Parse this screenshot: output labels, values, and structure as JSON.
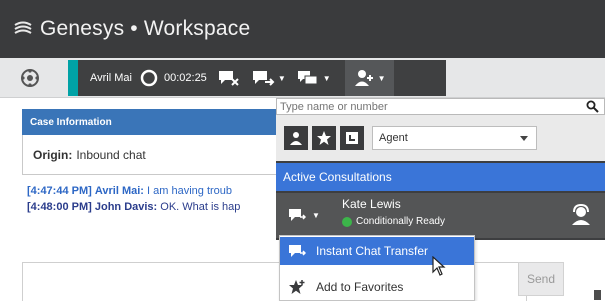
{
  "app": {
    "title": "Genesys • Workspace"
  },
  "toolbar": {
    "interaction": {
      "party_name": "Avril Mai",
      "timer": "00:02:25"
    }
  },
  "case": {
    "header": "Case Information",
    "origin_label": "Origin:",
    "origin_value": "Inbound chat"
  },
  "transcript": [
    {
      "time": "[4:47:44 PM]",
      "speaker": "Avril Mai:",
      "text": "I am having troub"
    },
    {
      "time": "[4:48:00 PM]",
      "speaker": "John Davis:",
      "text": "OK. What is hap"
    }
  ],
  "compose": {
    "send_label": "Send"
  },
  "team_communicator": {
    "search_placeholder": "Type name or number",
    "filter_selected": "Agent",
    "section_title": "Active Consultations",
    "contact": {
      "name": "Kate Lewis",
      "status": "Conditionally Ready"
    }
  },
  "context_menu": {
    "items": [
      {
        "label": "Instant Chat Transfer"
      },
      {
        "label": "Add to Favorites"
      }
    ]
  },
  "colors": {
    "accent_blue": "#3a75d8",
    "header_dark": "#3a3b3d",
    "teal_accent": "#00a2a6",
    "ready_green": "#3cb54a"
  }
}
